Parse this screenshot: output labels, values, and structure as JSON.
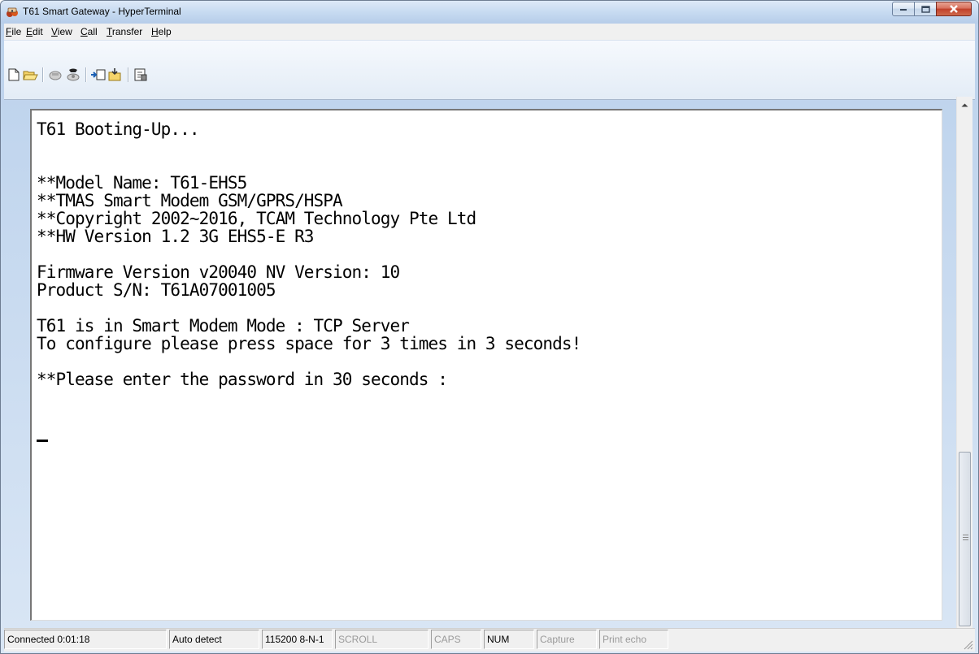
{
  "window": {
    "title": "T61 Smart Gateway - HyperTerminal"
  },
  "menu": [
    "File",
    "Edit",
    "View",
    "Call",
    "Transfer",
    "Help"
  ],
  "toolbar": [
    "new-connection-icon",
    "open-icon",
    "disconnect-icon",
    "dial-icon",
    "send-icon",
    "receive-icon",
    "properties-icon"
  ],
  "terminal": {
    "lines": [
      "T61 Booting-Up...",
      "",
      "",
      "**Model Name: T61-EHS5",
      "**TMAS Smart Modem GSM/GPRS/HSPA",
      "**Copyright 2002~2016, TCAM Technology Pte Ltd",
      "**HW Version 1.2 3G EHS5-E R3",
      "",
      "Firmware Version v20040 NV Version: 10",
      "Product S/N: T61A07001005",
      "",
      "T61 is in Smart Modem Mode : TCP Server",
      "To configure please press space for 3 times in 3 seconds!",
      "",
      "**Please enter the password in 30 seconds :"
    ]
  },
  "status": {
    "connected": "Connected 0:01:18",
    "detect": "Auto detect",
    "port": "115200 8-N-1",
    "scroll": "SCROLL",
    "caps": "CAPS",
    "num": "NUM",
    "capture": "Capture",
    "print_echo": "Print echo"
  }
}
